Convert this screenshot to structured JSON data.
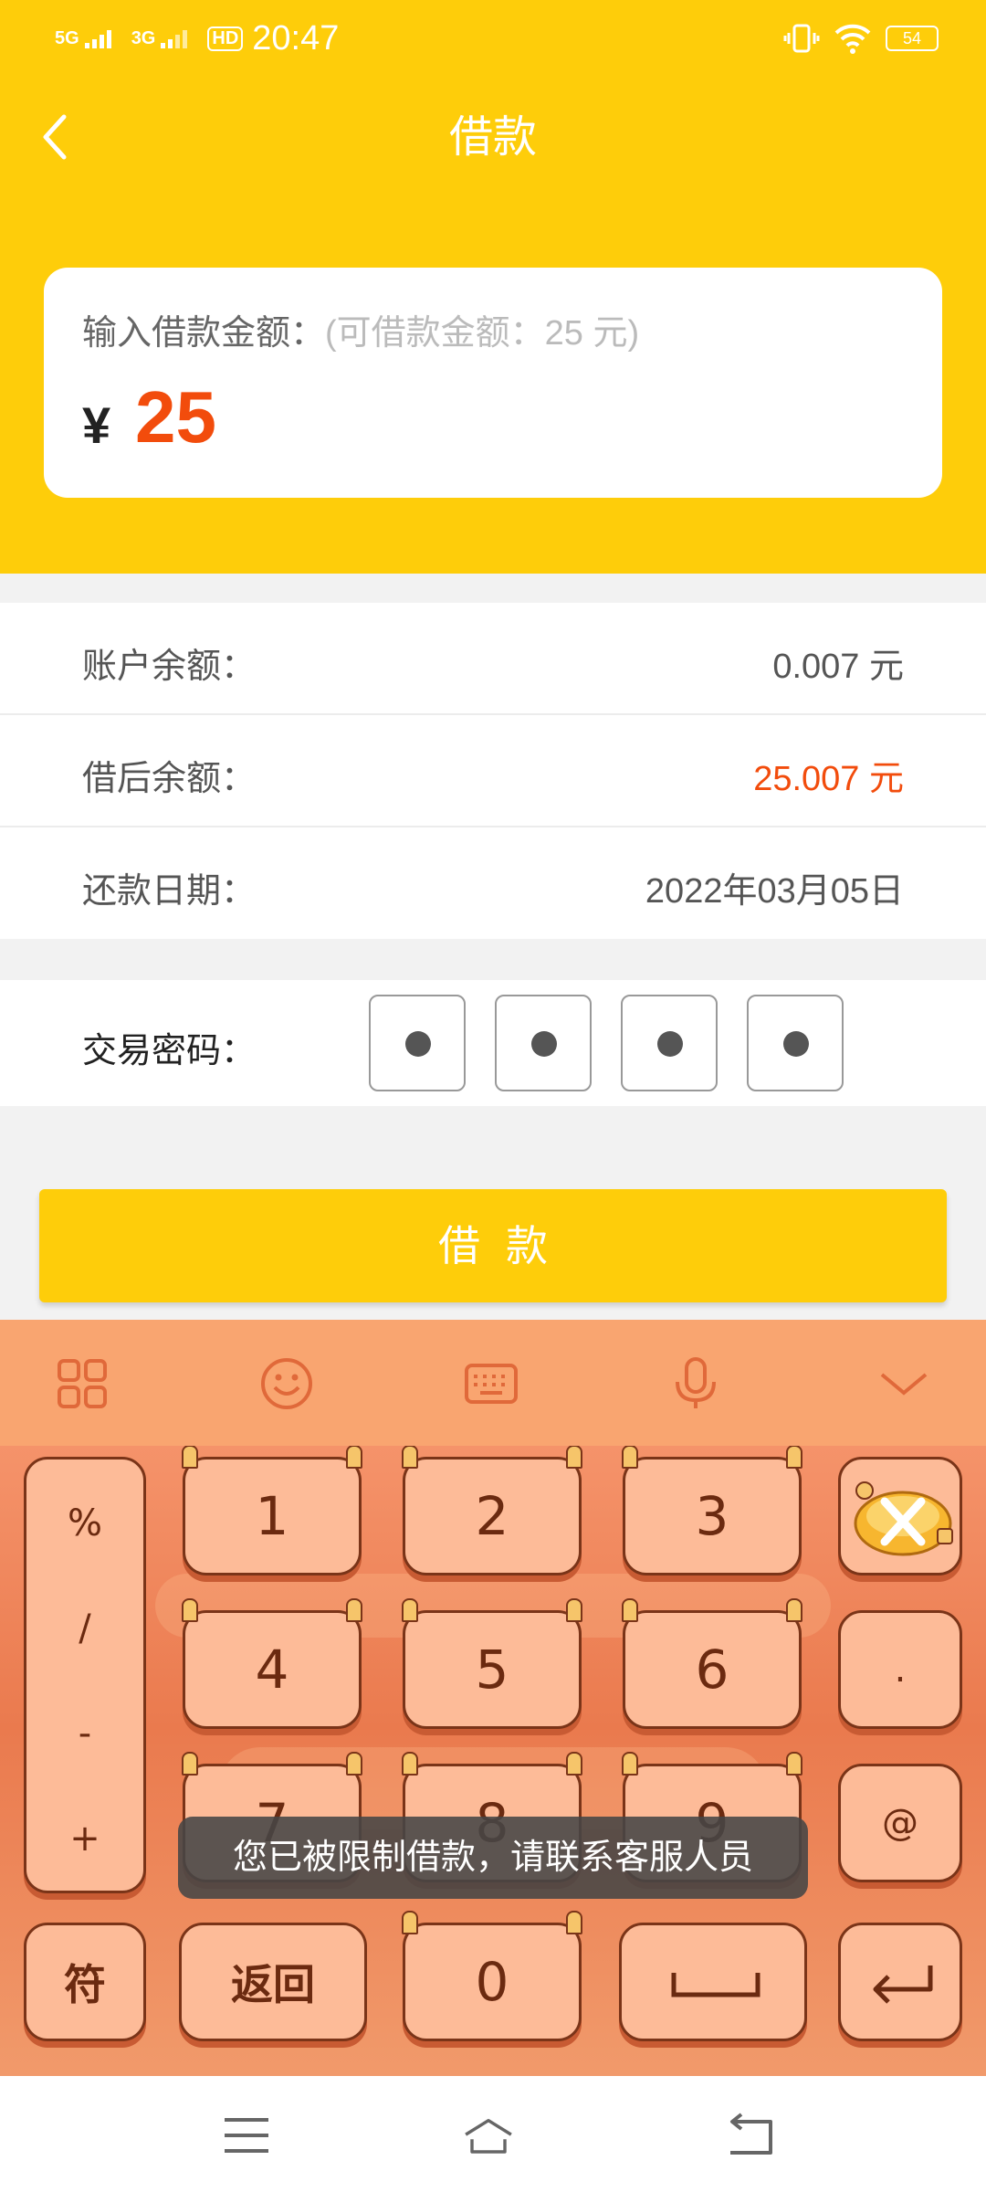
{
  "status_bar": {
    "signal1": "5G",
    "signal2": "3G",
    "hd": "HD",
    "time": "20:47",
    "battery": "54"
  },
  "header": {
    "title": "借款"
  },
  "amount_card": {
    "label": "输入借款金额：",
    "hint": "(可借款金额：25  元)",
    "currency": "¥",
    "value": "25"
  },
  "info_rows": [
    {
      "label": "账户余额：",
      "value": "0.007  元"
    },
    {
      "label": "借后余额：",
      "value": "25.007  元"
    },
    {
      "label": "还款日期：",
      "value": "2022年03月05日"
    }
  ],
  "password": {
    "label": "交易密码：",
    "dots": 4
  },
  "submit": {
    "label": "借款"
  },
  "keyboard": {
    "toolbar_icons": [
      "grid-icon",
      "emoji-icon",
      "keyboard-icon",
      "microphone-icon",
      "chevron-down-icon"
    ],
    "symbols_column": [
      "%",
      "/",
      "-",
      "+"
    ],
    "digits": [
      "1",
      "2",
      "3",
      "4",
      "5",
      "6",
      "7",
      "8",
      "9"
    ],
    "right_column": [
      ".",
      "@"
    ],
    "bottom_row": {
      "symbols": "符",
      "back": "返回",
      "zero": "0"
    }
  },
  "toast": "您已被限制借款，请联系客服人员",
  "navbar_icons": [
    "menu-icon",
    "home-icon",
    "back-icon"
  ],
  "colors": {
    "brand_yellow": "#fecd0a",
    "accent_orange": "#f24c0c"
  }
}
